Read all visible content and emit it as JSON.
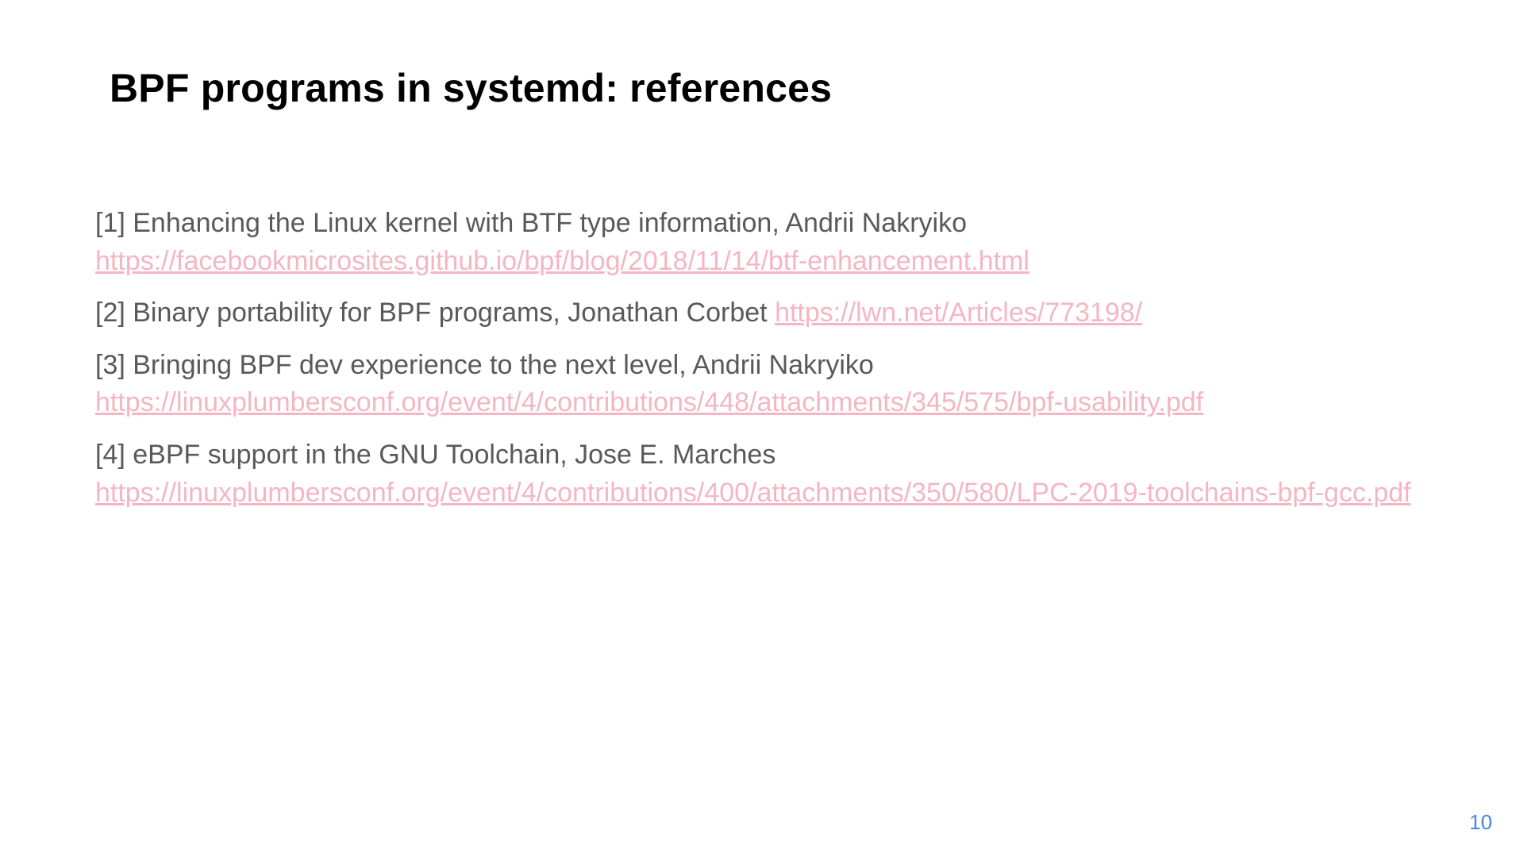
{
  "title": "BPF programs in systemd: references",
  "references": [
    {
      "desc": "[1] Enhancing the Linux kernel with BTF type information, Andrii Nakryiko",
      "link": "https://facebookmicrosites.github.io/bpf/blog/2018/11/14/btf-enhancement.html"
    },
    {
      "desc": "[2] Binary portability for BPF programs, Jonathan Corbet ",
      "link": "https://lwn.net/Articles/773198/"
    },
    {
      "desc": "[3] Bringing BPF dev experience to the next level, Andrii Nakryiko",
      "link": "https://linuxplumbersconf.org/event/4/contributions/448/attachments/345/575/bpf-usability.pdf"
    },
    {
      "desc": "[4] eBPF support in the GNU Toolchain, Jose E. Marches",
      "link": "https://linuxplumbersconf.org/event/4/contributions/400/attachments/350/580/LPC-2019-toolchains-bpf-gcc.pdf"
    }
  ],
  "page_number": "10"
}
